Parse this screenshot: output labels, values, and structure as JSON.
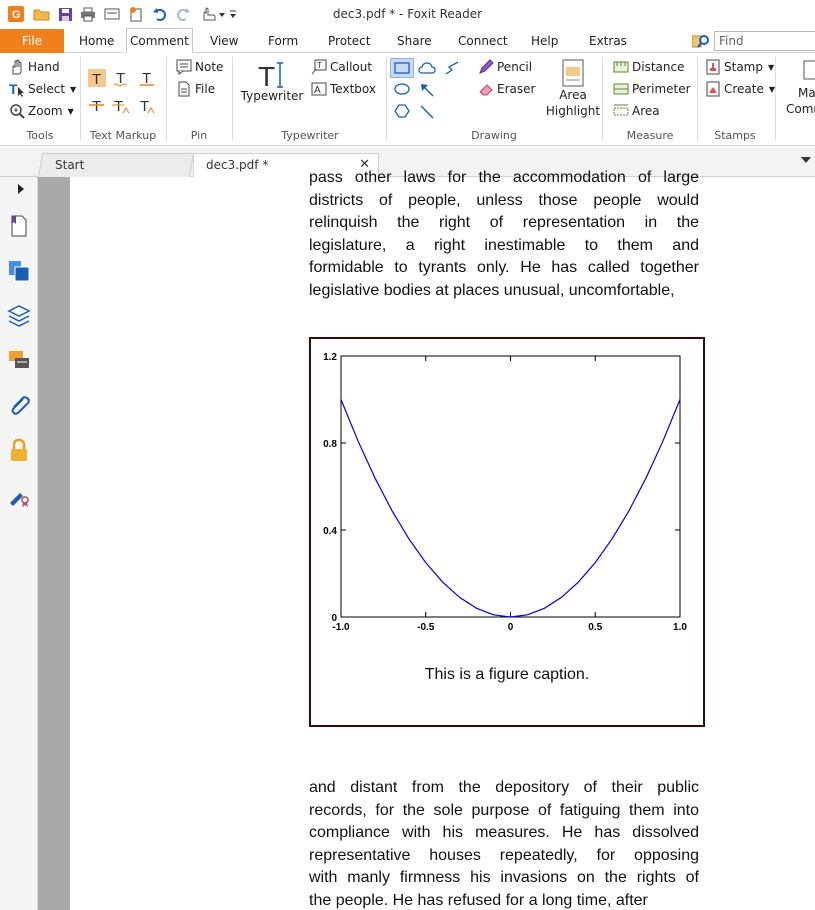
{
  "window": {
    "title": "dec3.pdf * - Foxit Reader"
  },
  "menubar": {
    "items": [
      "File",
      "Home",
      "Comment",
      "View",
      "Form",
      "Protect",
      "Share",
      "Connect",
      "Help",
      "Extras"
    ],
    "active": "Comment",
    "find_placeholder": "Find"
  },
  "ribbon": {
    "tools": {
      "hand": "Hand",
      "select": "Select",
      "zoom": "Zoom",
      "label": "Tools"
    },
    "text_markup": {
      "label": "Text Markup"
    },
    "pin": {
      "note": "Note",
      "file": "File",
      "label": "Pin"
    },
    "typewriter": {
      "typewriter": "Typewriter",
      "callout": "Callout",
      "textbox": "Textbox",
      "label": "Typewriter"
    },
    "drawing": {
      "pencil": "Pencil",
      "eraser": "Eraser",
      "area_highlight_1": "Area",
      "area_highlight_2": "Highlight",
      "label": "Drawing"
    },
    "measure": {
      "distance": "Distance",
      "perimeter": "Perimeter",
      "area": "Area",
      "label": "Measure"
    },
    "stamps": {
      "stamp": "Stamp",
      "create": "Create",
      "label": "Stamps"
    },
    "manage_1": "Mar",
    "manage_2": "Comm"
  },
  "tabs": {
    "start": "Start",
    "doc": "dec3.pdf *"
  },
  "document": {
    "para1": [
      "pass other laws for the accommodation of large",
      "districts of people, unless those people would",
      "relinquish the right of representation in the",
      "legislature, a right inestimable to them and",
      "formidable to tyrants only.  He has called together",
      "legislative bodies at places unusual, uncomfortable,"
    ],
    "caption": "This is a figure caption.",
    "para2": [
      "and distant from the depository of their public",
      "records, for the sole purpose of fatiguing them into",
      "compliance with his measures.  He has dissolved",
      "representative houses repeatedly, for opposing",
      "with manly firmness his invasions on the rights of",
      "the people.  He has refused for a long time, after"
    ]
  },
  "chart_data": {
    "type": "line",
    "title": "",
    "xlabel": "",
    "ylabel": "",
    "xlim": [
      -1.0,
      1.0
    ],
    "ylim": [
      0,
      1.2
    ],
    "xticks": [
      "-1.0",
      "-0.5",
      "0",
      "0.5",
      "1.0"
    ],
    "yticks": [
      "0",
      "0.4",
      "0.8",
      "1.2"
    ],
    "grid": false,
    "series": [
      {
        "color": "#0000ee",
        "x": [
          -1.0,
          -0.9,
          -0.8,
          -0.7,
          -0.6,
          -0.5,
          -0.4,
          -0.3,
          -0.2,
          -0.1,
          0.0,
          0.1,
          0.2,
          0.3,
          0.4,
          0.5,
          0.6,
          0.7,
          0.8,
          0.9,
          1.0
        ],
        "y": [
          1.0,
          0.81,
          0.64,
          0.49,
          0.36,
          0.25,
          0.16,
          0.09,
          0.04,
          0.01,
          0.0,
          0.01,
          0.04,
          0.09,
          0.16,
          0.25,
          0.36,
          0.49,
          0.64,
          0.81,
          1.0
        ]
      }
    ]
  }
}
